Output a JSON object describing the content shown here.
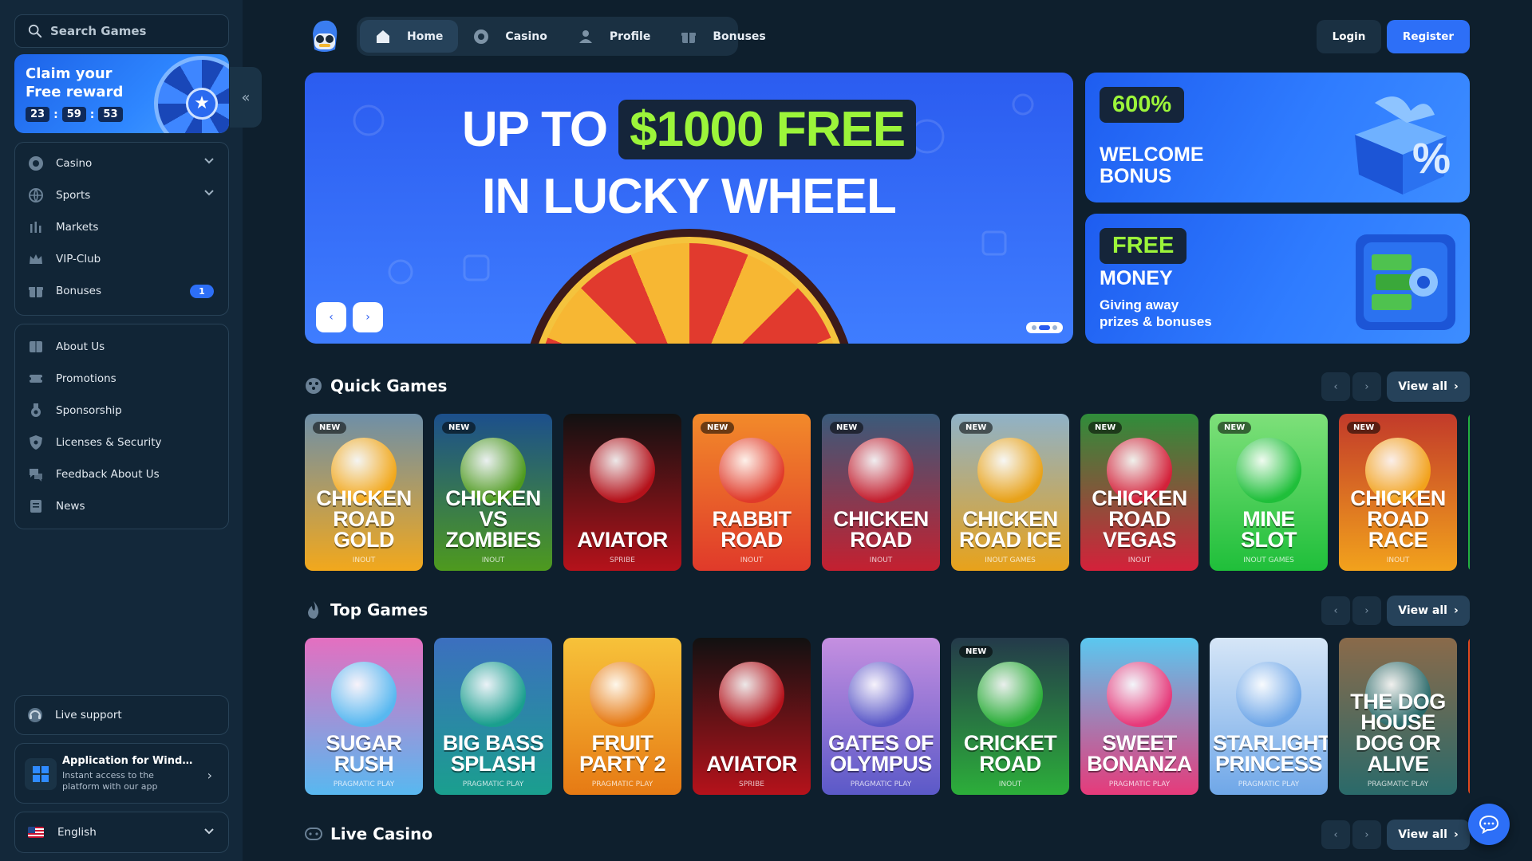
{
  "sidebar": {
    "search_placeholder": "Search Games",
    "claim": {
      "title": "Claim your Free reward",
      "hours": "23",
      "minutes": "59",
      "seconds": "53"
    },
    "main_nav": [
      {
        "label": "Casino",
        "icon": "casino-chip-icon",
        "expandable": true
      },
      {
        "label": "Sports",
        "icon": "globe-ball-icon",
        "expandable": true
      },
      {
        "label": "Markets",
        "icon": "chart-bars-icon"
      },
      {
        "label": "VIP-Club",
        "icon": "crown-icon"
      },
      {
        "label": "Bonuses",
        "icon": "gift-icon",
        "badge": "1"
      }
    ],
    "info_nav": [
      {
        "label": "About Us",
        "icon": "book-icon"
      },
      {
        "label": "Promotions",
        "icon": "ticket-icon"
      },
      {
        "label": "Sponsorship",
        "icon": "medal-icon"
      },
      {
        "label": "Licenses & Security",
        "icon": "shield-icon"
      },
      {
        "label": "Feedback About Us",
        "icon": "chat-bubbles-icon"
      },
      {
        "label": "News",
        "icon": "newspaper-icon"
      }
    ],
    "support_label": "Live support",
    "app": {
      "title": "Application for Windows",
      "description": "Instant access to the platform with our app"
    },
    "language": "English"
  },
  "topnav": {
    "tabs": [
      {
        "label": "Home",
        "icon": "home-icon",
        "active": true
      },
      {
        "label": "Casino",
        "icon": "chip-icon"
      },
      {
        "label": "Profile",
        "icon": "user-icon"
      },
      {
        "label": "Bonuses",
        "icon": "gift-icon"
      }
    ],
    "login_label": "Login",
    "register_label": "Register"
  },
  "hero": {
    "line1_prefix": "UP TO",
    "line1_amount": "$1000 FREE",
    "line2": "IN LUCKY WHEEL",
    "slides": 3,
    "active_slide": 2
  },
  "promos": [
    {
      "tag": "600%",
      "text": "WELCOME BONUS"
    },
    {
      "tag": "FREE",
      "text": "MONEY",
      "sub": "Giving away prizes & bonuses"
    }
  ],
  "sections": {
    "quick": {
      "title": "Quick Games",
      "view_all": "View all"
    },
    "top": {
      "title": "Top Games",
      "view_all": "View all"
    },
    "live": {
      "title": "Live Casino",
      "view_all": "View all"
    }
  },
  "quick_games": [
    {
      "title": "Chicken Road Gold",
      "provider": "INOUT",
      "new": "NEW",
      "color1": "#f2a81c",
      "color2": "#6e8fa8"
    },
    {
      "title": "Chicken vs Zombies",
      "provider": "INOUT",
      "new": "NEW",
      "color1": "#4e9a1e",
      "color2": "#1c4f8c"
    },
    {
      "title": "Aviator",
      "provider": "SPRIBE",
      "color1": "#b5121b",
      "color2": "#111111"
    },
    {
      "title": "Rabbit Road",
      "provider": "INOUT",
      "new": "NEW",
      "color1": "#e03a2a",
      "color2": "#f28a2a"
    },
    {
      "title": "Chicken Road",
      "provider": "INOUT",
      "new": "NEW",
      "color1": "#c42030",
      "color2": "#3a5a7a"
    },
    {
      "title": "Chicken Road Ice",
      "provider": "INOUT GAMES",
      "new": "NEW",
      "color1": "#e8a21a",
      "color2": "#8fb2c8"
    },
    {
      "title": "Chicken Road Vegas",
      "provider": "INOUT",
      "new": "NEW",
      "color1": "#d4213a",
      "color2": "#2f8d3a"
    },
    {
      "title": "Mine Slot",
      "provider": "INOUT GAMES",
      "new": "NEW",
      "color1": "#1fbf3a",
      "color2": "#7ee07a"
    },
    {
      "title": "Chicken Road Race",
      "provider": "INOUT",
      "new": "NEW",
      "color1": "#f2a21c",
      "color2": "#c23a2a"
    }
  ],
  "top_games": [
    {
      "title": "Sugar Rush",
      "provider": "PRAGMATIC PLAY",
      "color1": "#58b8f0",
      "color2": "#e46fc0"
    },
    {
      "title": "Big Bass Splash",
      "provider": "PRAGMATIC PLAY",
      "color1": "#1a9f8e",
      "color2": "#3c6fbf"
    },
    {
      "title": "Fruit Party 2",
      "provider": "PRAGMATIC PLAY",
      "color1": "#e67a14",
      "color2": "#f7c23a"
    },
    {
      "title": "Aviator",
      "provider": "SPRIBE",
      "color1": "#b5121b",
      "color2": "#111111"
    },
    {
      "title": "Gates of Olympus",
      "provider": "PRAGMATIC PLAY",
      "color1": "#5b59c8",
      "color2": "#c58fe0"
    },
    {
      "title": "Cricket Road",
      "provider": "INOUT",
      "new": "NEW",
      "color1": "#2cae3a",
      "color2": "#243a4a"
    },
    {
      "title": "Sweet Bonanza",
      "provider": "PRAGMATIC PLAY",
      "color1": "#e63a7a",
      "color2": "#5ac8f0"
    },
    {
      "title": "Starlight Princess",
      "provider": "PRAGMATIC PLAY",
      "color1": "#6fa7e8",
      "color2": "#d6e6f7"
    },
    {
      "title": "The Dog House Dog or Alive",
      "provider": "PRAGMATIC PLAY",
      "color1": "#2a6a6a",
      "color2": "#8a6a4a"
    }
  ],
  "colors": {
    "accent": "#2d6ff7",
    "background": "#0e1f2d",
    "sidebar": "#13283a",
    "green": "#9cf53a"
  }
}
